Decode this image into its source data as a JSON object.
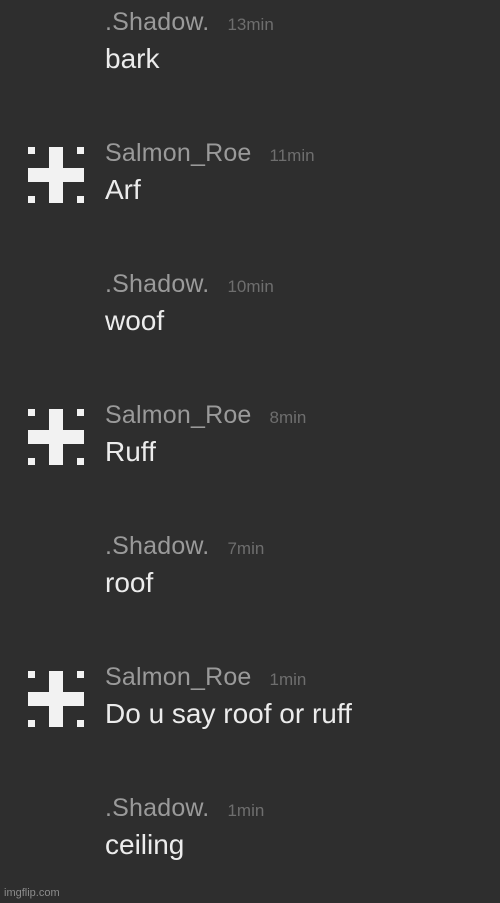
{
  "colors": {
    "background": "#2e2e2e",
    "author": "#9a9a9a",
    "timestamp": "#6e6e6e",
    "message": "#ececec",
    "avatar": "#f2f2f2"
  },
  "messages": [
    {
      "author": ".Shadow.",
      "time": "13min",
      "text": "bark",
      "avatar": "none"
    },
    {
      "author": "Salmon_Roe",
      "time": "11min",
      "text": "Arf",
      "avatar": "pixel-pattern-icon"
    },
    {
      "author": ".Shadow.",
      "time": "10min",
      "text": "woof",
      "avatar": "none"
    },
    {
      "author": "Salmon_Roe",
      "time": "8min",
      "text": "Ruff",
      "avatar": "pixel-pattern-icon"
    },
    {
      "author": ".Shadow.",
      "time": "7min",
      "text": "roof",
      "avatar": "none"
    },
    {
      "author": "Salmon_Roe",
      "time": "1min",
      "text": "Do u say roof or ruff",
      "avatar": "pixel-pattern-icon"
    },
    {
      "author": ".Shadow.",
      "time": "1min",
      "text": "ceiling",
      "avatar": "none"
    }
  ],
  "watermark": "imgflip.com"
}
